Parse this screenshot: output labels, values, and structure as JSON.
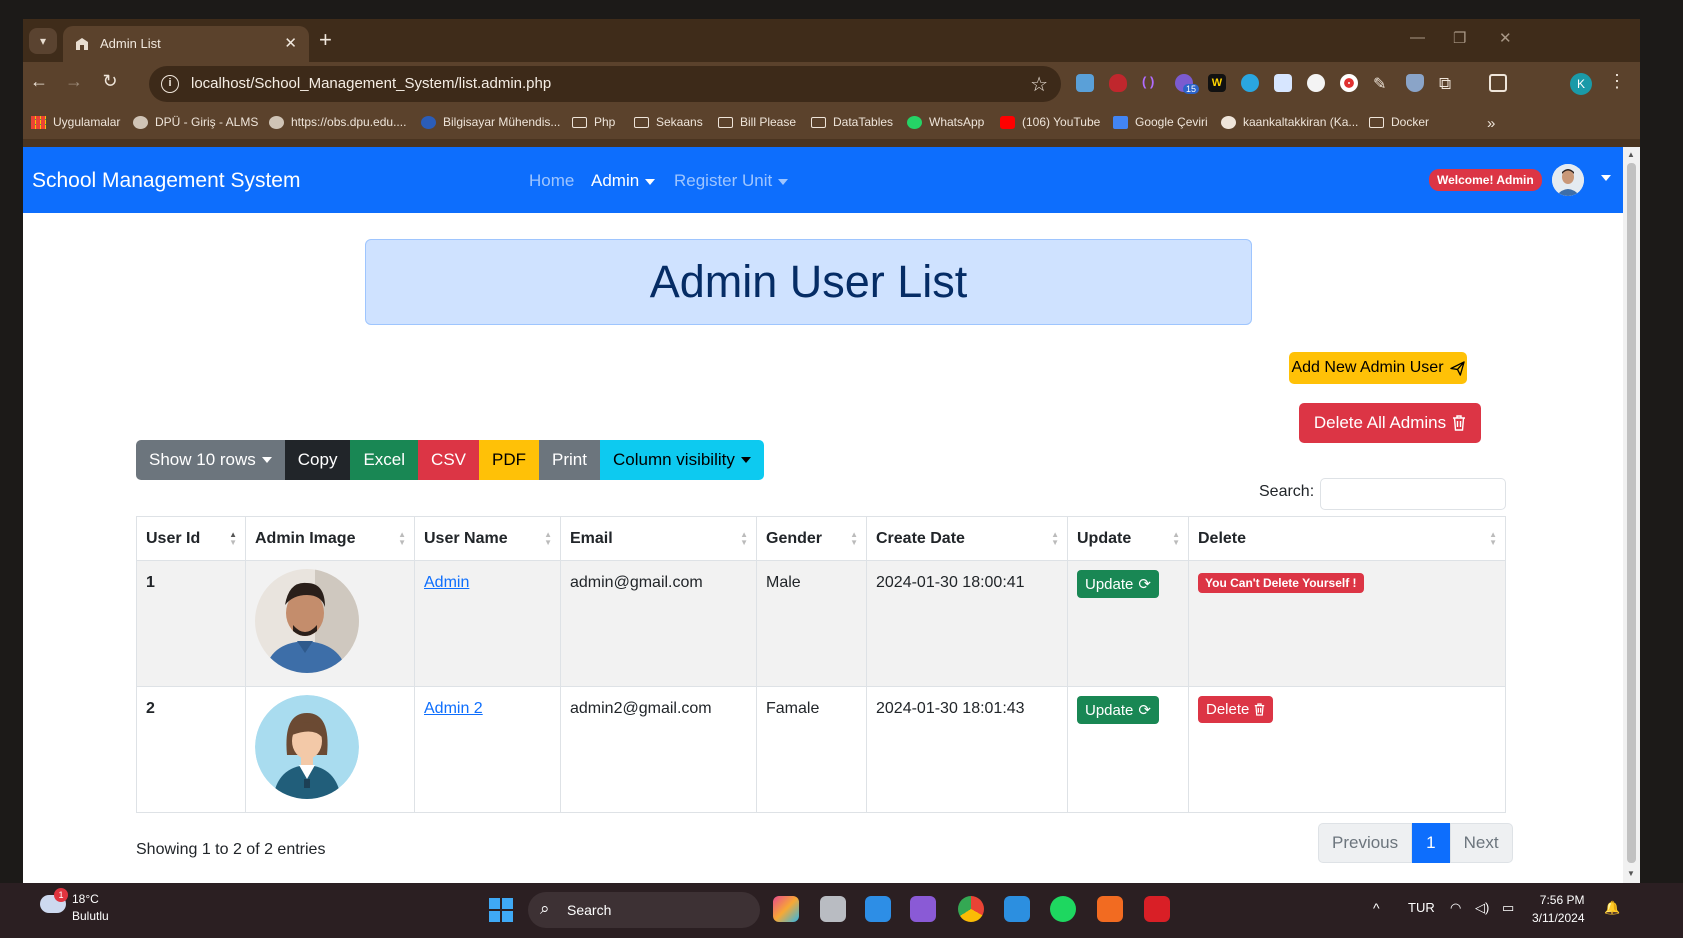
{
  "browser": {
    "tab_title": "Admin List",
    "url": "localhost/School_Management_System/list.admin.php",
    "bookmarks": [
      "Uygulamalar",
      "DPÜ - Giriş - ALMS",
      "https://obs.dpu.edu....",
      "Bilgisayar Mühendis...",
      "Php",
      "Sekaans",
      "Bill Please",
      "DataTables",
      "WhatsApp",
      "(106) YouTube",
      "Google Çeviri",
      "kaankaltakkiran (Ka...",
      "Docker"
    ],
    "profile_initial": "K",
    "ext_badge": "15"
  },
  "navbar": {
    "brand": "School Management System",
    "links": [
      "Home",
      "Admin",
      "Register Unit"
    ],
    "welcome": "Welcome! Admin"
  },
  "page": {
    "title": "Admin User List",
    "add_button": "Add New Admin User",
    "delete_all_button": "Delete All Admins"
  },
  "datatable": {
    "buttons": [
      "Show 10 rows",
      "Copy",
      "Excel",
      "CSV",
      "PDF",
      "Print",
      "Column visibility"
    ],
    "search_label": "Search:",
    "columns": [
      "User Id",
      "Admin Image",
      "User Name",
      "Email",
      "Gender",
      "Create Date",
      "Update",
      "Delete"
    ],
    "rows": [
      {
        "id": "1",
        "username": "Admin",
        "email": "admin@gmail.com",
        "gender": "Male",
        "created": "2024-01-30 18:00:41",
        "update_label": "Update",
        "delete_label": "You Can't Delete Yourself !"
      },
      {
        "id": "2",
        "username": "Admin 2",
        "email": "admin2@gmail.com",
        "gender": "Famale",
        "created": "2024-01-30 18:01:43",
        "update_label": "Update",
        "delete_label": "Delete"
      }
    ],
    "info": "Showing 1 to 2 of 2 entries",
    "pagination": [
      "Previous",
      "1",
      "Next"
    ]
  },
  "taskbar": {
    "temperature": "18°C",
    "weather": "Bulutlu",
    "weather_badge": "1",
    "search": "Search",
    "language": "TUR",
    "time": "7:56 PM",
    "date": "3/11/2024"
  },
  "colors": {
    "primary": "#0d6efd",
    "danger": "#dc3545",
    "success": "#198754",
    "warning": "#ffc107",
    "info": "#0dcaf0",
    "secondary": "#6c757d",
    "dark": "#212529",
    "title_bg": "#cfe2ff"
  }
}
